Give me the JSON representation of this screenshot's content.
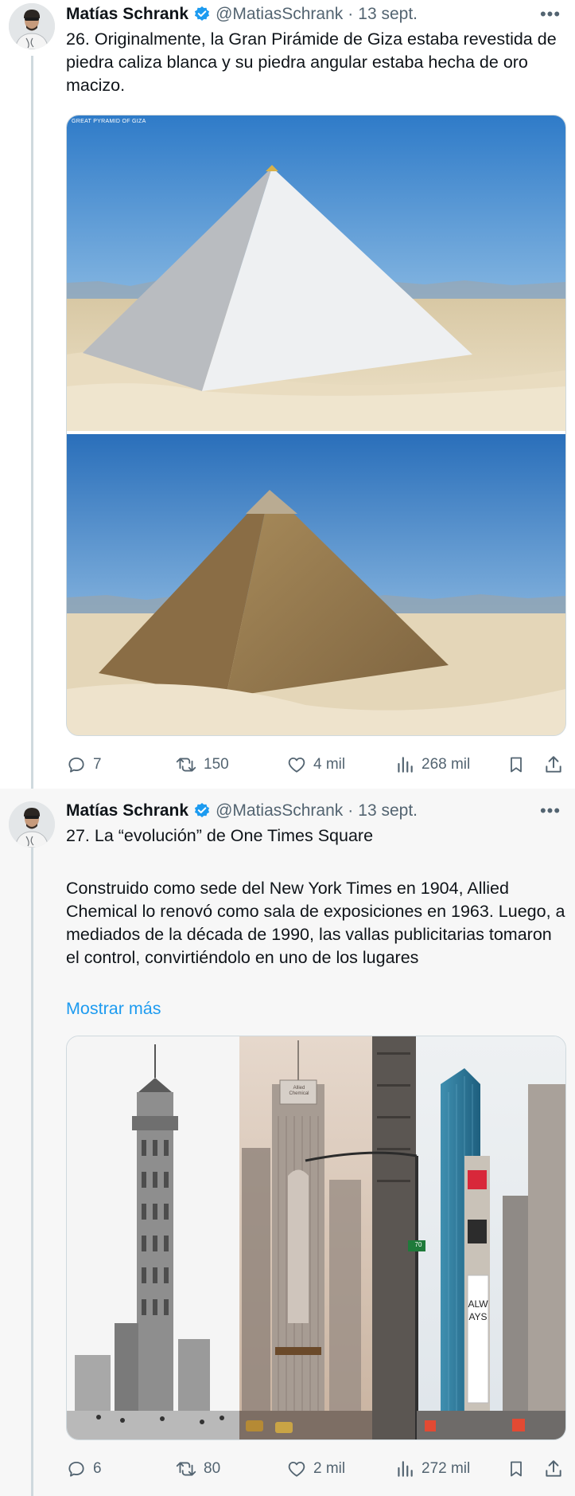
{
  "tweets": [
    {
      "author": {
        "name": "Matías Schrank",
        "handle": "@MatiasSchrank",
        "date": "13 sept."
      },
      "text": "26. Originalmente, la Gran Pirámide de Giza estaba revestida de piedra caliza blanca y su piedra angular estaba hecha de oro macizo.",
      "media": {
        "caption": "GREAT PYRAMID OF GIZA"
      },
      "stats": {
        "replies": "7",
        "retweets": "150",
        "likes": "4 mil",
        "views": "268 mil"
      }
    },
    {
      "author": {
        "name": "Matías Schrank",
        "handle": "@MatiasSchrank",
        "date": "13 sept."
      },
      "title": "27. La “evolución” de One Times Square",
      "body": "Construido como sede del New York Times en 1904, Allied Chemical lo renovó como sala de exposiciones en 1963. Luego, a mediados de la década de 1990, las vallas publicitarias tomaron el control, convirtiéndolo en uno de los lugares",
      "show_more": "Mostrar más",
      "media": {
        "sign_allied": "Allied Chemical",
        "sign_always": "ALWAYS",
        "sign_70": "70"
      },
      "stats": {
        "replies": "6",
        "retweets": "80",
        "likes": "2 mil",
        "views": "272 mil"
      }
    }
  ],
  "separator": "·",
  "more_glyph": "•••",
  "colors": {
    "accent": "#1d9bf0",
    "muted": "#536471",
    "text": "#0f1419",
    "border": "#cfd9de"
  }
}
